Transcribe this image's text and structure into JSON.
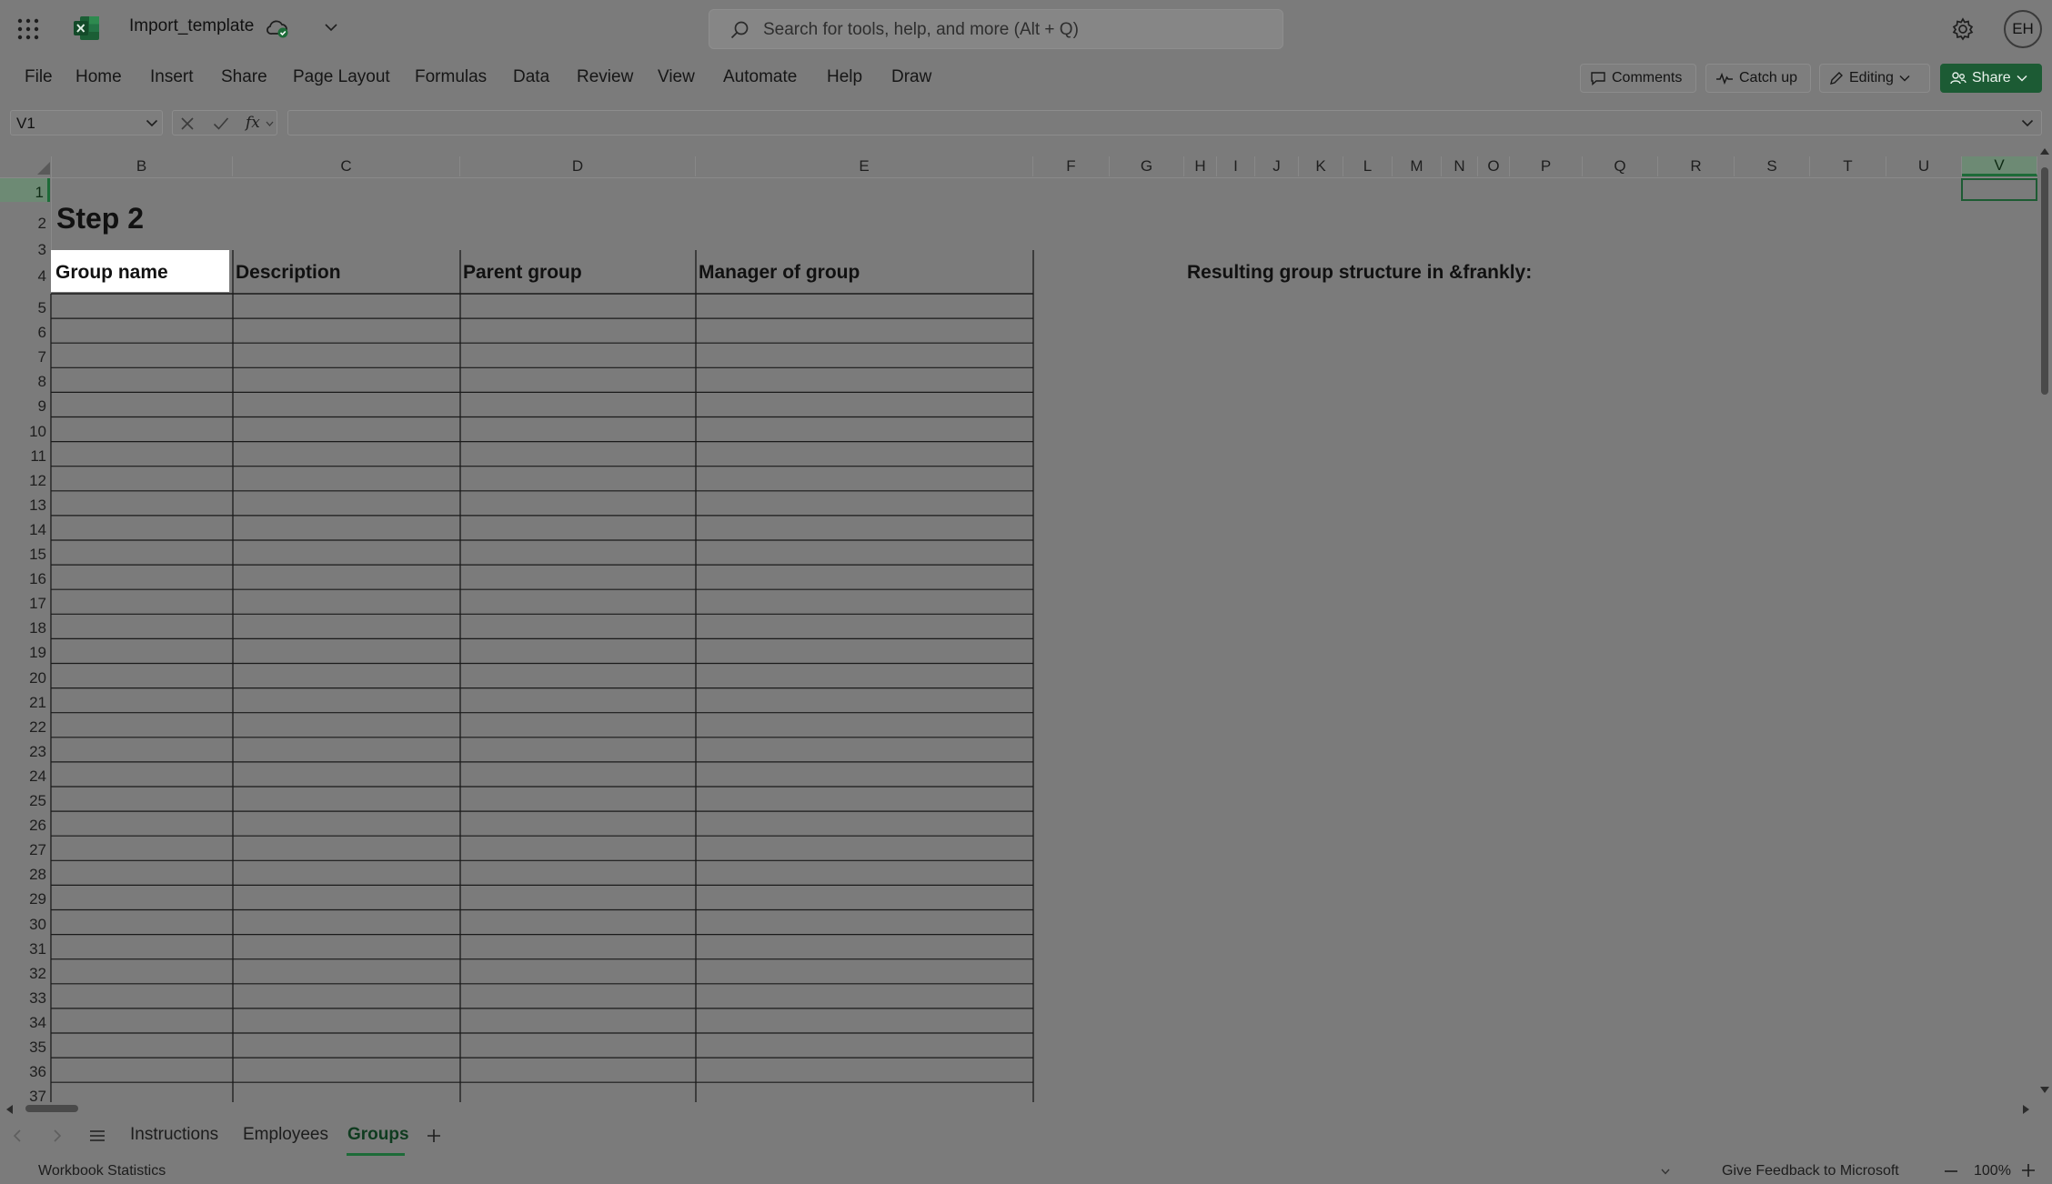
{
  "app": {
    "doc_title": "Import_template",
    "search_placeholder": "Search for tools, help, and more (Alt + Q)",
    "user_initials": "EH",
    "accent": "#1d6b38"
  },
  "ribbon": {
    "tabs": [
      "File",
      "Home",
      "Insert",
      "Share",
      "Page Layout",
      "Formulas",
      "Data",
      "Review",
      "View",
      "Automate",
      "Help",
      "Draw"
    ],
    "comments": "Comments",
    "catch_up": "Catch up",
    "editing": "Editing",
    "share": "Share"
  },
  "formula_bar": {
    "name_box": "V1",
    "fx": "fx",
    "value": ""
  },
  "grid": {
    "columns": [
      "B",
      "C",
      "D",
      "E",
      "F",
      "G",
      "H",
      "I",
      "J",
      "K",
      "L",
      "M",
      "N",
      "O",
      "P",
      "Q",
      "R",
      "S",
      "T",
      "U",
      "V"
    ],
    "selected_column": "V",
    "rows": [
      "1",
      "2",
      "3",
      "4",
      "5",
      "6",
      "7",
      "8",
      "9",
      "10",
      "11",
      "12",
      "13",
      "14",
      "15",
      "16",
      "17",
      "18",
      "19",
      "20",
      "21",
      "22",
      "23",
      "24",
      "25",
      "26",
      "27",
      "28",
      "29",
      "30",
      "31",
      "32",
      "33",
      "34",
      "35",
      "36",
      "37"
    ],
    "selected_row": "1"
  },
  "sheet": {
    "title": "Step 2",
    "headers": [
      "Group name",
      "Description",
      "Parent group",
      "Manager of group"
    ],
    "result_label": "Resulting group structure in &frankly:"
  },
  "sheet_tabs": {
    "tabs": [
      "Instructions",
      "Employees",
      "Groups"
    ],
    "active": "Groups"
  },
  "status": {
    "workbook_statistics": "Workbook Statistics",
    "feedback": "Give Feedback to Microsoft",
    "zoom": "100%"
  }
}
